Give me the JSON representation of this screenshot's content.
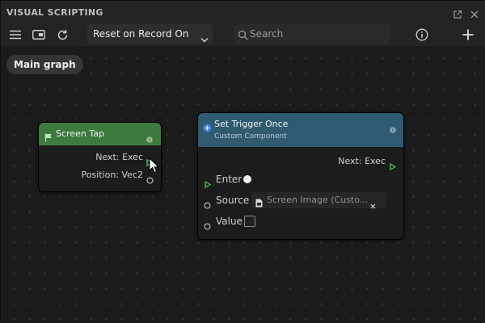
{
  "window": {
    "title": "VISUAL SCRIPTING"
  },
  "icons": {
    "popout": "popout-icon",
    "close": "close-icon",
    "menu": "hamburger-icon",
    "layout": "panel-layout-icon",
    "refresh": "refresh-icon",
    "info": "info-icon",
    "add": "plus-icon",
    "search": "search-icon",
    "chevron": "chevron-down-icon"
  },
  "toolbar": {
    "mode_selected": "Reset on Record On",
    "search_placeholder": "Search"
  },
  "graph": {
    "breadcrumb": "Main graph"
  },
  "nodes": {
    "screen_tap": {
      "title": "Screen Tap",
      "header_color": "#3d7a3d",
      "outputs": [
        "Next: Exec",
        "Position: Vec2"
      ]
    },
    "set_trigger": {
      "title": "Set Trigger Once",
      "subtitle": "Custom Component",
      "header_color": "#2f5a70",
      "output": "Next: Exec",
      "inputs": {
        "enter": "Enter",
        "source": "Source",
        "source_value": "Screen Image (Custo...",
        "value": "Value"
      }
    }
  },
  "colors": {
    "exec_port": "#4fbf4f",
    "accent_blue": "#3e7fd9"
  }
}
